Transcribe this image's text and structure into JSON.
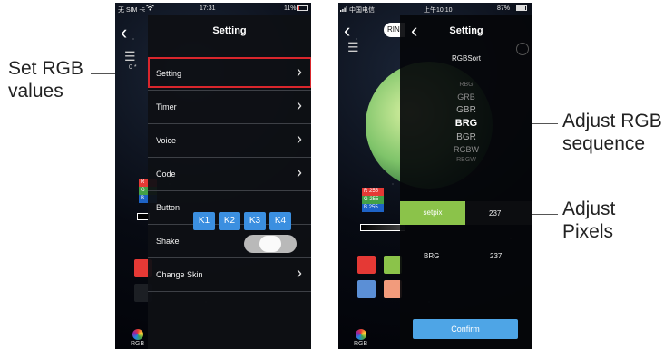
{
  "callouts": {
    "set_rgb": "Set RGB\nvalues",
    "adjust_seq": "Adjust RGB\nsequence",
    "adjust_pix": "Adjust\nPixels"
  },
  "left_phone": {
    "status": {
      "carrier": "无 SIM 卡 ",
      "time": "17:31",
      "battery": "11%"
    },
    "title": "Setting",
    "counter": "0 *",
    "menu": [
      {
        "label": "Setting"
      },
      {
        "label": "Timer"
      },
      {
        "label": "Voice"
      },
      {
        "label": "Code"
      },
      {
        "label": "Button"
      },
      {
        "label": "Shake"
      },
      {
        "label": "Change Skin"
      }
    ],
    "buttons": [
      "K1",
      "K2",
      "K3",
      "K4"
    ],
    "rgb_badge": {
      "r": "R",
      "g": "G",
      "b": "B"
    },
    "bottom_tab": "RGB",
    "colors": {
      "accent": "#3b8fe0",
      "highlight": "#d9262c"
    }
  },
  "right_phone": {
    "status": {
      "carrier": "中国电信 ",
      "time": "上午10:10",
      "battery": "87%"
    },
    "tab_fragment": "RIN",
    "title": "Setting",
    "section": "RGBSort",
    "sort_options": [
      "RBG",
      "GRB",
      "GBR",
      "BRG",
      "BGR",
      "RGBW",
      "RBGW"
    ],
    "selected_sort": "BRG",
    "rgb_badge": {
      "r": "R 255",
      "g": "G 255",
      "b": "B 255"
    },
    "setpix_label": "setpix",
    "pixel_value": "237",
    "current_sort": "BRG",
    "current_pixels": "237",
    "confirm_label": "Confirm",
    "bottom_tab": "RGB"
  }
}
